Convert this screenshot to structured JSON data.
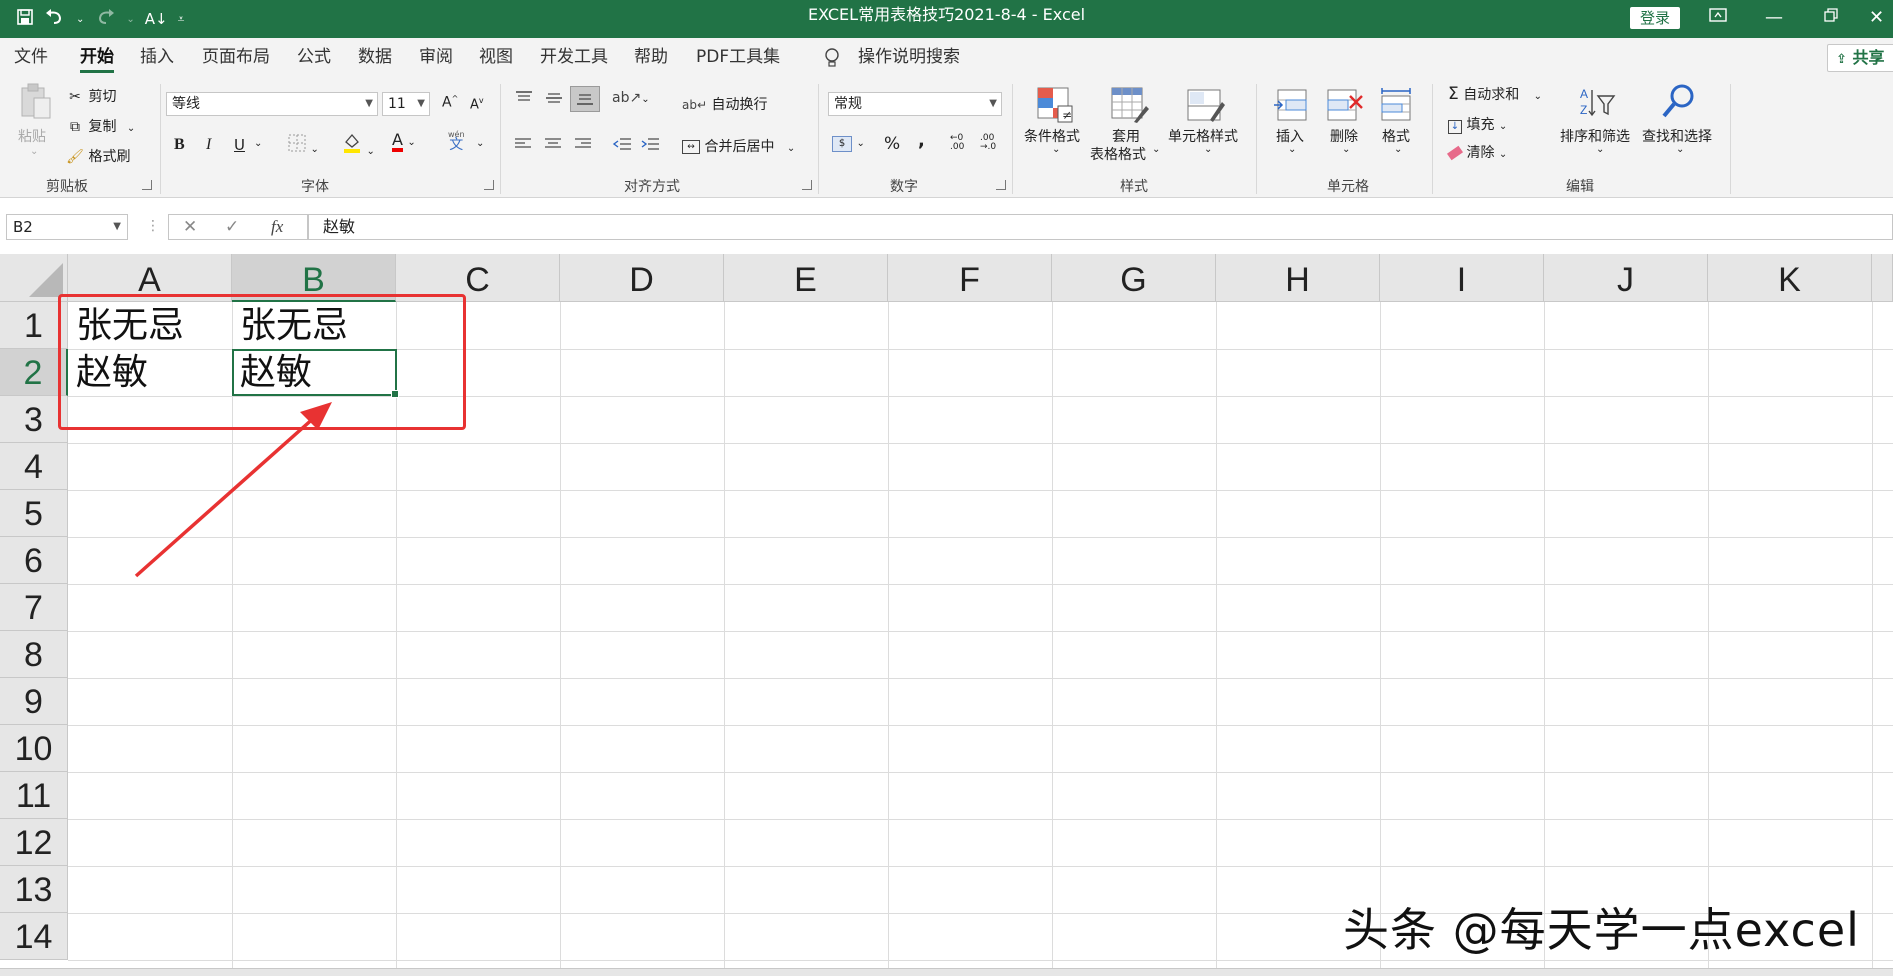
{
  "titlebar": {
    "doc_title": "EXCEL常用表格技巧2021-8-4  -  Excel",
    "login_label": "登录",
    "qat_icons": [
      "save-icon",
      "undo-icon",
      "redo-icon",
      "sort-icon",
      "customize-qat-icon"
    ]
  },
  "menu": {
    "tabs": [
      "文件",
      "开始",
      "插入",
      "页面布局",
      "公式",
      "数据",
      "审阅",
      "视图",
      "开发工具",
      "帮助",
      "PDF工具集"
    ],
    "active_tab": "开始",
    "tell_me": "操作说明搜索",
    "share_label": "共享"
  },
  "ribbon": {
    "clipboard": {
      "label": "剪贴板",
      "paste": "粘贴",
      "cut": "剪切",
      "copy": "复制",
      "format_painter": "格式刷"
    },
    "font": {
      "label": "字体",
      "font_name": "等线",
      "font_size": "11",
      "bold": "B",
      "italic": "I",
      "underline": "U",
      "increase": "A",
      "decrease": "A",
      "font_color_letter": "A",
      "phonetic": "wén",
      "phonetic_char": "文"
    },
    "alignment": {
      "label": "对齐方式",
      "wrap_text": "自动换行",
      "merge_center": "合并后居中"
    },
    "number": {
      "label": "数字",
      "format": "常规",
      "percent": "%",
      "comma": ","
    },
    "styles": {
      "label": "样式",
      "conditional": "条件格式",
      "table_line1": "套用",
      "table_line2": "表格格式",
      "cell_styles": "单元格样式"
    },
    "cells": {
      "label": "单元格",
      "insert": "插入",
      "delete": "删除",
      "format": "格式"
    },
    "editing": {
      "label": "编辑",
      "autosum": "自动求和",
      "fill": "填充",
      "clear": "清除",
      "sort_filter": "排序和筛选",
      "find_select": "查找和选择"
    }
  },
  "formula_bar": {
    "name_box": "B2",
    "cancel": "✕",
    "enter": "✓",
    "fx": "fx",
    "content": "赵敏"
  },
  "sheet": {
    "columns": [
      "A",
      "B",
      "C",
      "D",
      "E",
      "F",
      "G",
      "H",
      "I",
      "J",
      "K"
    ],
    "rows": [
      "1",
      "2",
      "3",
      "4",
      "5",
      "6",
      "7",
      "8",
      "9",
      "10",
      "11",
      "12",
      "13",
      "14"
    ],
    "selected_column": "B",
    "selected_row": "2",
    "cells": {
      "A1": "张无忌",
      "B1": "张无忌",
      "A2": "赵敏",
      "B2": "赵敏"
    }
  },
  "watermark": "头条 @每天学一点excel",
  "colors": {
    "excel_green": "#217346",
    "annotation_red": "#e83232"
  }
}
